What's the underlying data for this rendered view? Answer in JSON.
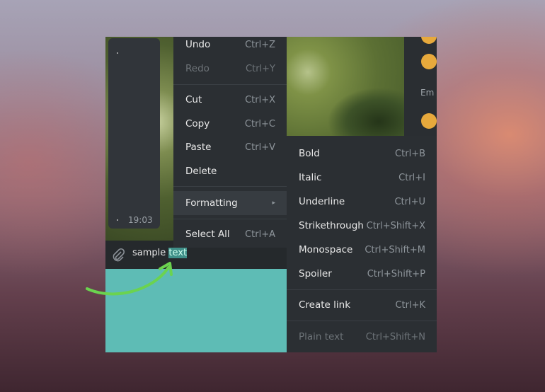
{
  "chat": {
    "time": "19:03",
    "input_text_plain": "sample ",
    "input_text_selected": "text",
    "emoji_label": "Em"
  },
  "context_menu": {
    "items": [
      {
        "label": "Undo",
        "shortcut": "Ctrl+Z",
        "disabled": false
      },
      {
        "label": "Redo",
        "shortcut": "Ctrl+Y",
        "disabled": true
      },
      {
        "label": "Cut",
        "shortcut": "Ctrl+X",
        "disabled": false
      },
      {
        "label": "Copy",
        "shortcut": "Ctrl+C",
        "disabled": false
      },
      {
        "label": "Paste",
        "shortcut": "Ctrl+V",
        "disabled": false
      },
      {
        "label": "Delete",
        "shortcut": "",
        "disabled": false
      },
      {
        "label": "Formatting",
        "shortcut": "▸",
        "disabled": false,
        "highlighted": true
      },
      {
        "label": "Select All",
        "shortcut": "Ctrl+A",
        "disabled": false
      }
    ]
  },
  "formatting_menu": {
    "items": [
      {
        "label": "Bold",
        "shortcut": "Ctrl+B"
      },
      {
        "label": "Italic",
        "shortcut": "Ctrl+I"
      },
      {
        "label": "Underline",
        "shortcut": "Ctrl+U"
      },
      {
        "label": "Strikethrough",
        "shortcut": "Ctrl+Shift+X"
      },
      {
        "label": "Monospace",
        "shortcut": "Ctrl+Shift+M"
      },
      {
        "label": "Spoiler",
        "shortcut": "Ctrl+Shift+P"
      },
      {
        "label": "Create link",
        "shortcut": "Ctrl+K"
      },
      {
        "label": "Plain text",
        "shortcut": "Ctrl+Shift+N",
        "disabled": true
      }
    ]
  },
  "colors": {
    "accent_teal": "#5ebcb5",
    "menu_bg": "#2b2f33",
    "arrow": "#6bd34f"
  }
}
